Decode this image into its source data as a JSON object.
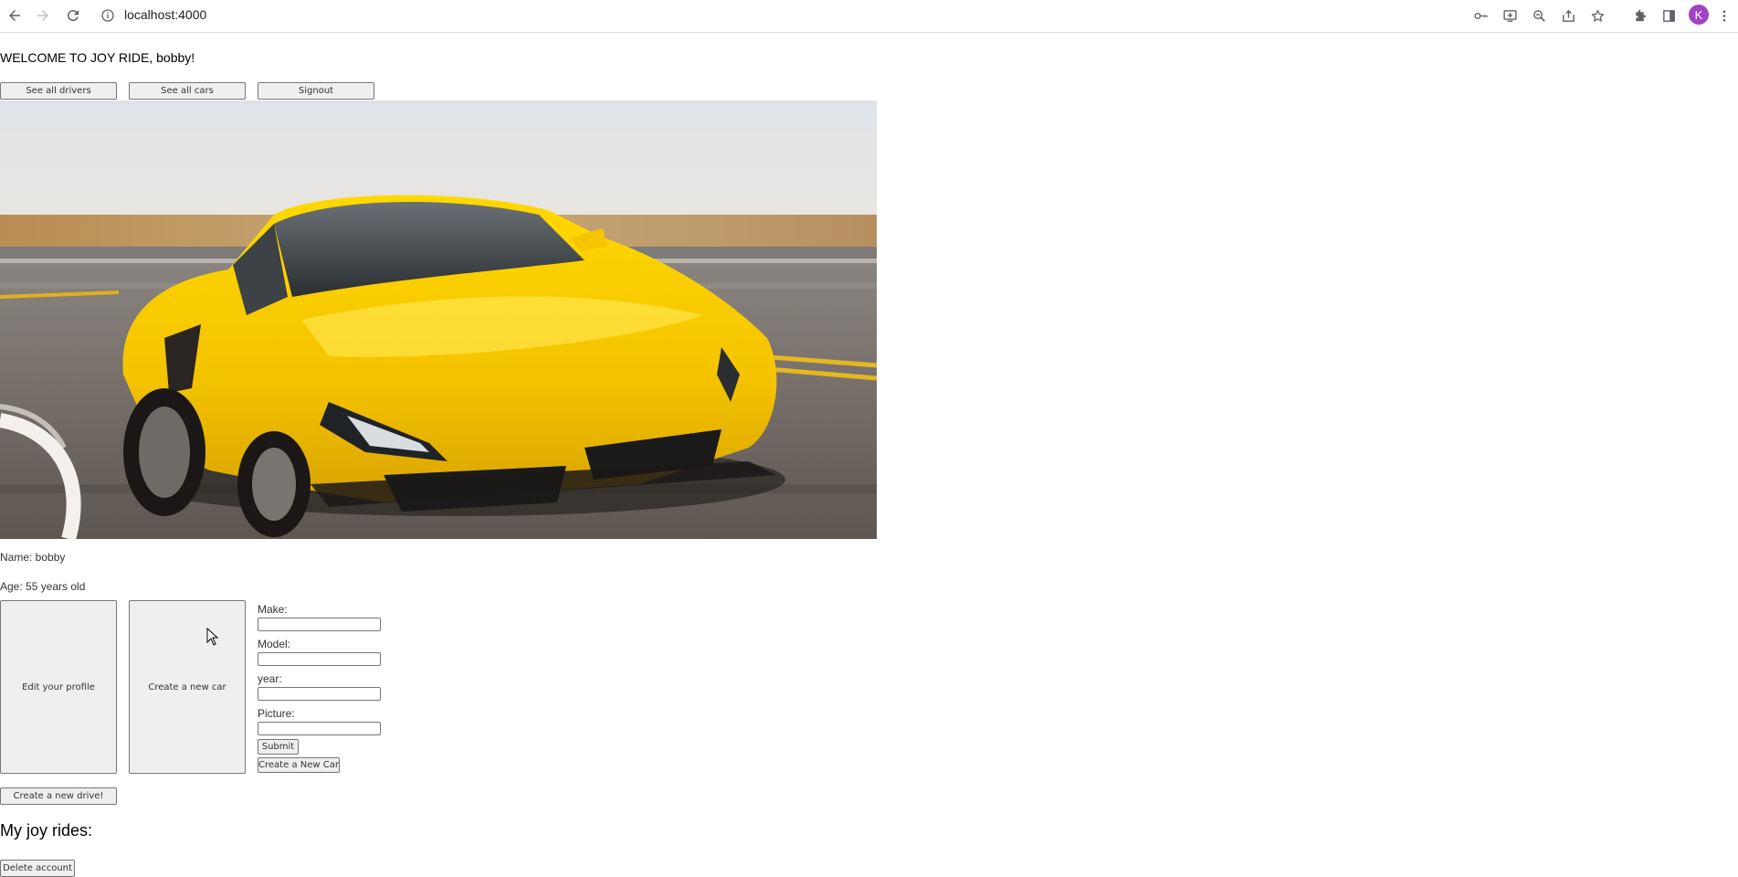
{
  "browser": {
    "url": "localhost:4000",
    "avatar_initial": "K",
    "icons": [
      "back-arrow-icon",
      "forward-arrow-icon",
      "reload-icon",
      "info-icon",
      "key-icon",
      "install-app-icon",
      "zoom-icon",
      "share-icon",
      "star-icon",
      "extensions-icon",
      "side-panel-icon",
      "more-menu-icon"
    ]
  },
  "page": {
    "welcome": "WELCOME TO JOY RIDE, bobby!",
    "nav": {
      "drivers_label": "See all drivers",
      "cars_label": "See all cars",
      "signout_label": "Signout"
    },
    "profile": {
      "name_line": "Name: bobby",
      "age_line": "Age: 55 years old"
    },
    "actions": {
      "edit_profile_label": "Edit your profile",
      "create_car_label": "Create a new car"
    },
    "car_form": {
      "make_label": "Make:",
      "model_label": "Model:",
      "year_label": "year:",
      "picture_label": "Picture:",
      "make_value": "",
      "model_value": "",
      "year_value": "",
      "picture_value": "",
      "submit_label": "Submit",
      "create_new_car_label": "Create a New Car"
    },
    "create_drive_label": "Create a new drive!",
    "rides_heading": "My joy rides:",
    "delete_label": "Delete account"
  },
  "colors": {
    "avatar": "#a142c8",
    "car_yellow": "#f6c500",
    "button_bg": "#efefef"
  }
}
